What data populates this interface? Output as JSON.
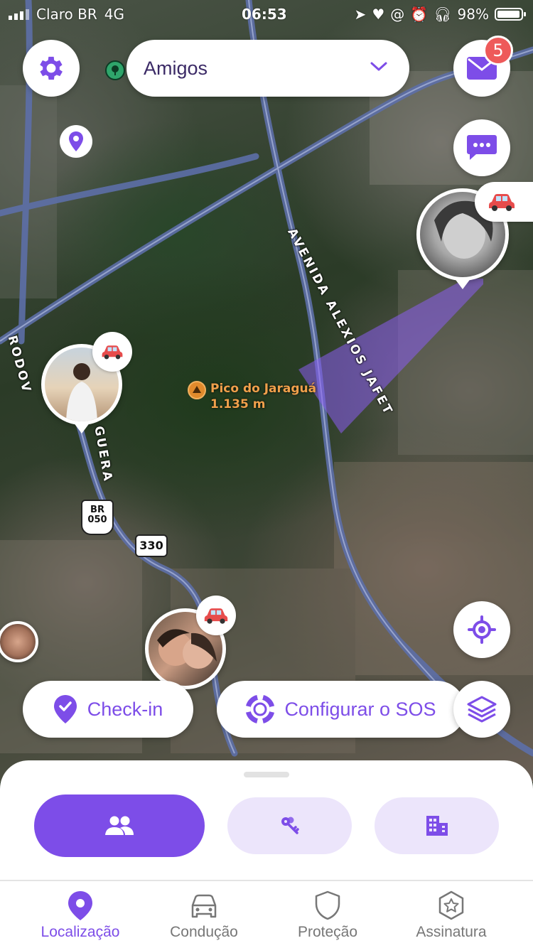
{
  "status_bar": {
    "carrier": "Claro BR",
    "network": "4G",
    "time": "06:53",
    "battery": "98%"
  },
  "header": {
    "group_label": "Amigos",
    "mail_badge": "5"
  },
  "map": {
    "road_avenida": "AVENIDA ALEXIOS JAFET",
    "road_rodovia_top": "RODOV",
    "road_rodovia_bottom": "GUERA",
    "poi_name": "Pico do Jaraguá",
    "poi_elevation": "1.135 m",
    "shield_br_line1": "BR",
    "shield_br_line2": "050",
    "shield_330": "330"
  },
  "actions": {
    "checkin_label": "Check-in",
    "sos_label": "Configurar o SOS"
  },
  "tabs": [
    {
      "label": "Localização",
      "icon": "location-pin-icon",
      "active": true
    },
    {
      "label": "Condução",
      "icon": "car-icon",
      "active": false
    },
    {
      "label": "Proteção",
      "icon": "shield-icon",
      "active": false
    },
    {
      "label": "Assinatura",
      "icon": "star-badge-icon",
      "active": false
    }
  ],
  "colors": {
    "accent": "#7d4de8",
    "accent_light": "#ece5fb",
    "badge": "#ee5a5a",
    "car": "#e74c4c"
  }
}
